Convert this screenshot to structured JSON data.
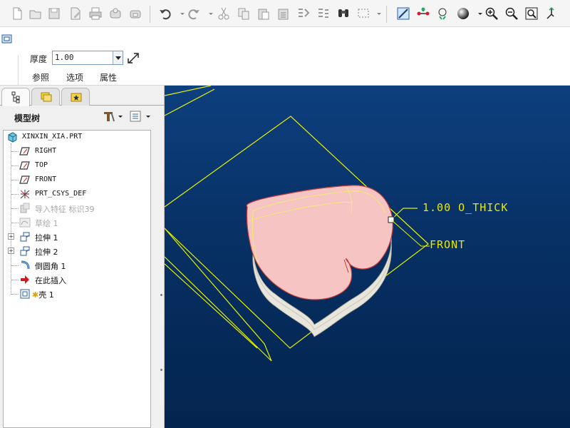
{
  "toolbar": {
    "icons": [
      "new-file-icon",
      "open-folder-icon",
      "save-icon",
      "save-as-icon",
      "print-icon",
      "send-icon",
      "send-mail-icon",
      "undo-icon",
      "redo-icon",
      "cut-icon",
      "copy-icon",
      "paste-icon",
      "paste-special-icon",
      "regenerate-icon",
      "regen-manager-icon",
      "find-icon",
      "select-box-icon",
      "datum-display-icon",
      "axis-display-icon",
      "point-display-icon",
      "shading-icon",
      "zoom-in-icon",
      "zoom-out-icon",
      "refit-icon",
      "reorient-icon"
    ]
  },
  "dashboard": {
    "thickness_label": "厚度",
    "thickness_value": "1.00",
    "tabs": [
      "参照",
      "选项",
      "属性"
    ]
  },
  "model_tree": {
    "title": "模型树",
    "items": [
      {
        "label": "XINXIN_XIA.PRT",
        "icon": "part-icon",
        "mono": true,
        "dim": false,
        "expandable": false
      },
      {
        "label": "RIGHT",
        "icon": "datum-plane-icon",
        "mono": true,
        "dim": false,
        "expandable": false
      },
      {
        "label": "TOP",
        "icon": "datum-plane-icon",
        "mono": true,
        "dim": false,
        "expandable": false
      },
      {
        "label": "FRONT",
        "icon": "datum-plane-icon",
        "mono": true,
        "dim": false,
        "expandable": false
      },
      {
        "label": "PRT_CSYS_DEF",
        "icon": "csys-icon",
        "mono": true,
        "dim": false,
        "expandable": false
      },
      {
        "label": "导入特征 标识39",
        "icon": "import-feature-icon",
        "mono": false,
        "dim": true,
        "expandable": false
      },
      {
        "label": "草绘 1",
        "icon": "sketch-icon",
        "mono": false,
        "dim": true,
        "expandable": false
      },
      {
        "label": "拉伸 1",
        "icon": "extrude-icon",
        "mono": false,
        "dim": false,
        "expandable": true
      },
      {
        "label": "拉伸 2",
        "icon": "extrude-icon",
        "mono": false,
        "dim": false,
        "expandable": true
      },
      {
        "label": "倒圆角 1",
        "icon": "round-icon",
        "mono": false,
        "dim": false,
        "expandable": false
      },
      {
        "label": "在此插入",
        "icon": "insert-here-arrow-icon",
        "mono": false,
        "dim": false,
        "expandable": false
      },
      {
        "label": "壳 1",
        "icon": "shell-icon",
        "mono": false,
        "dim": false,
        "expandable": false
      }
    ]
  },
  "viewport": {
    "thickness_annotation": "1.00 O_THICK",
    "datum_label": "FRONT",
    "colors": {
      "background": "#073064",
      "datum": "#e6f000",
      "part_top": "#f6c4c2",
      "part_side": "#e8e6dc"
    }
  }
}
